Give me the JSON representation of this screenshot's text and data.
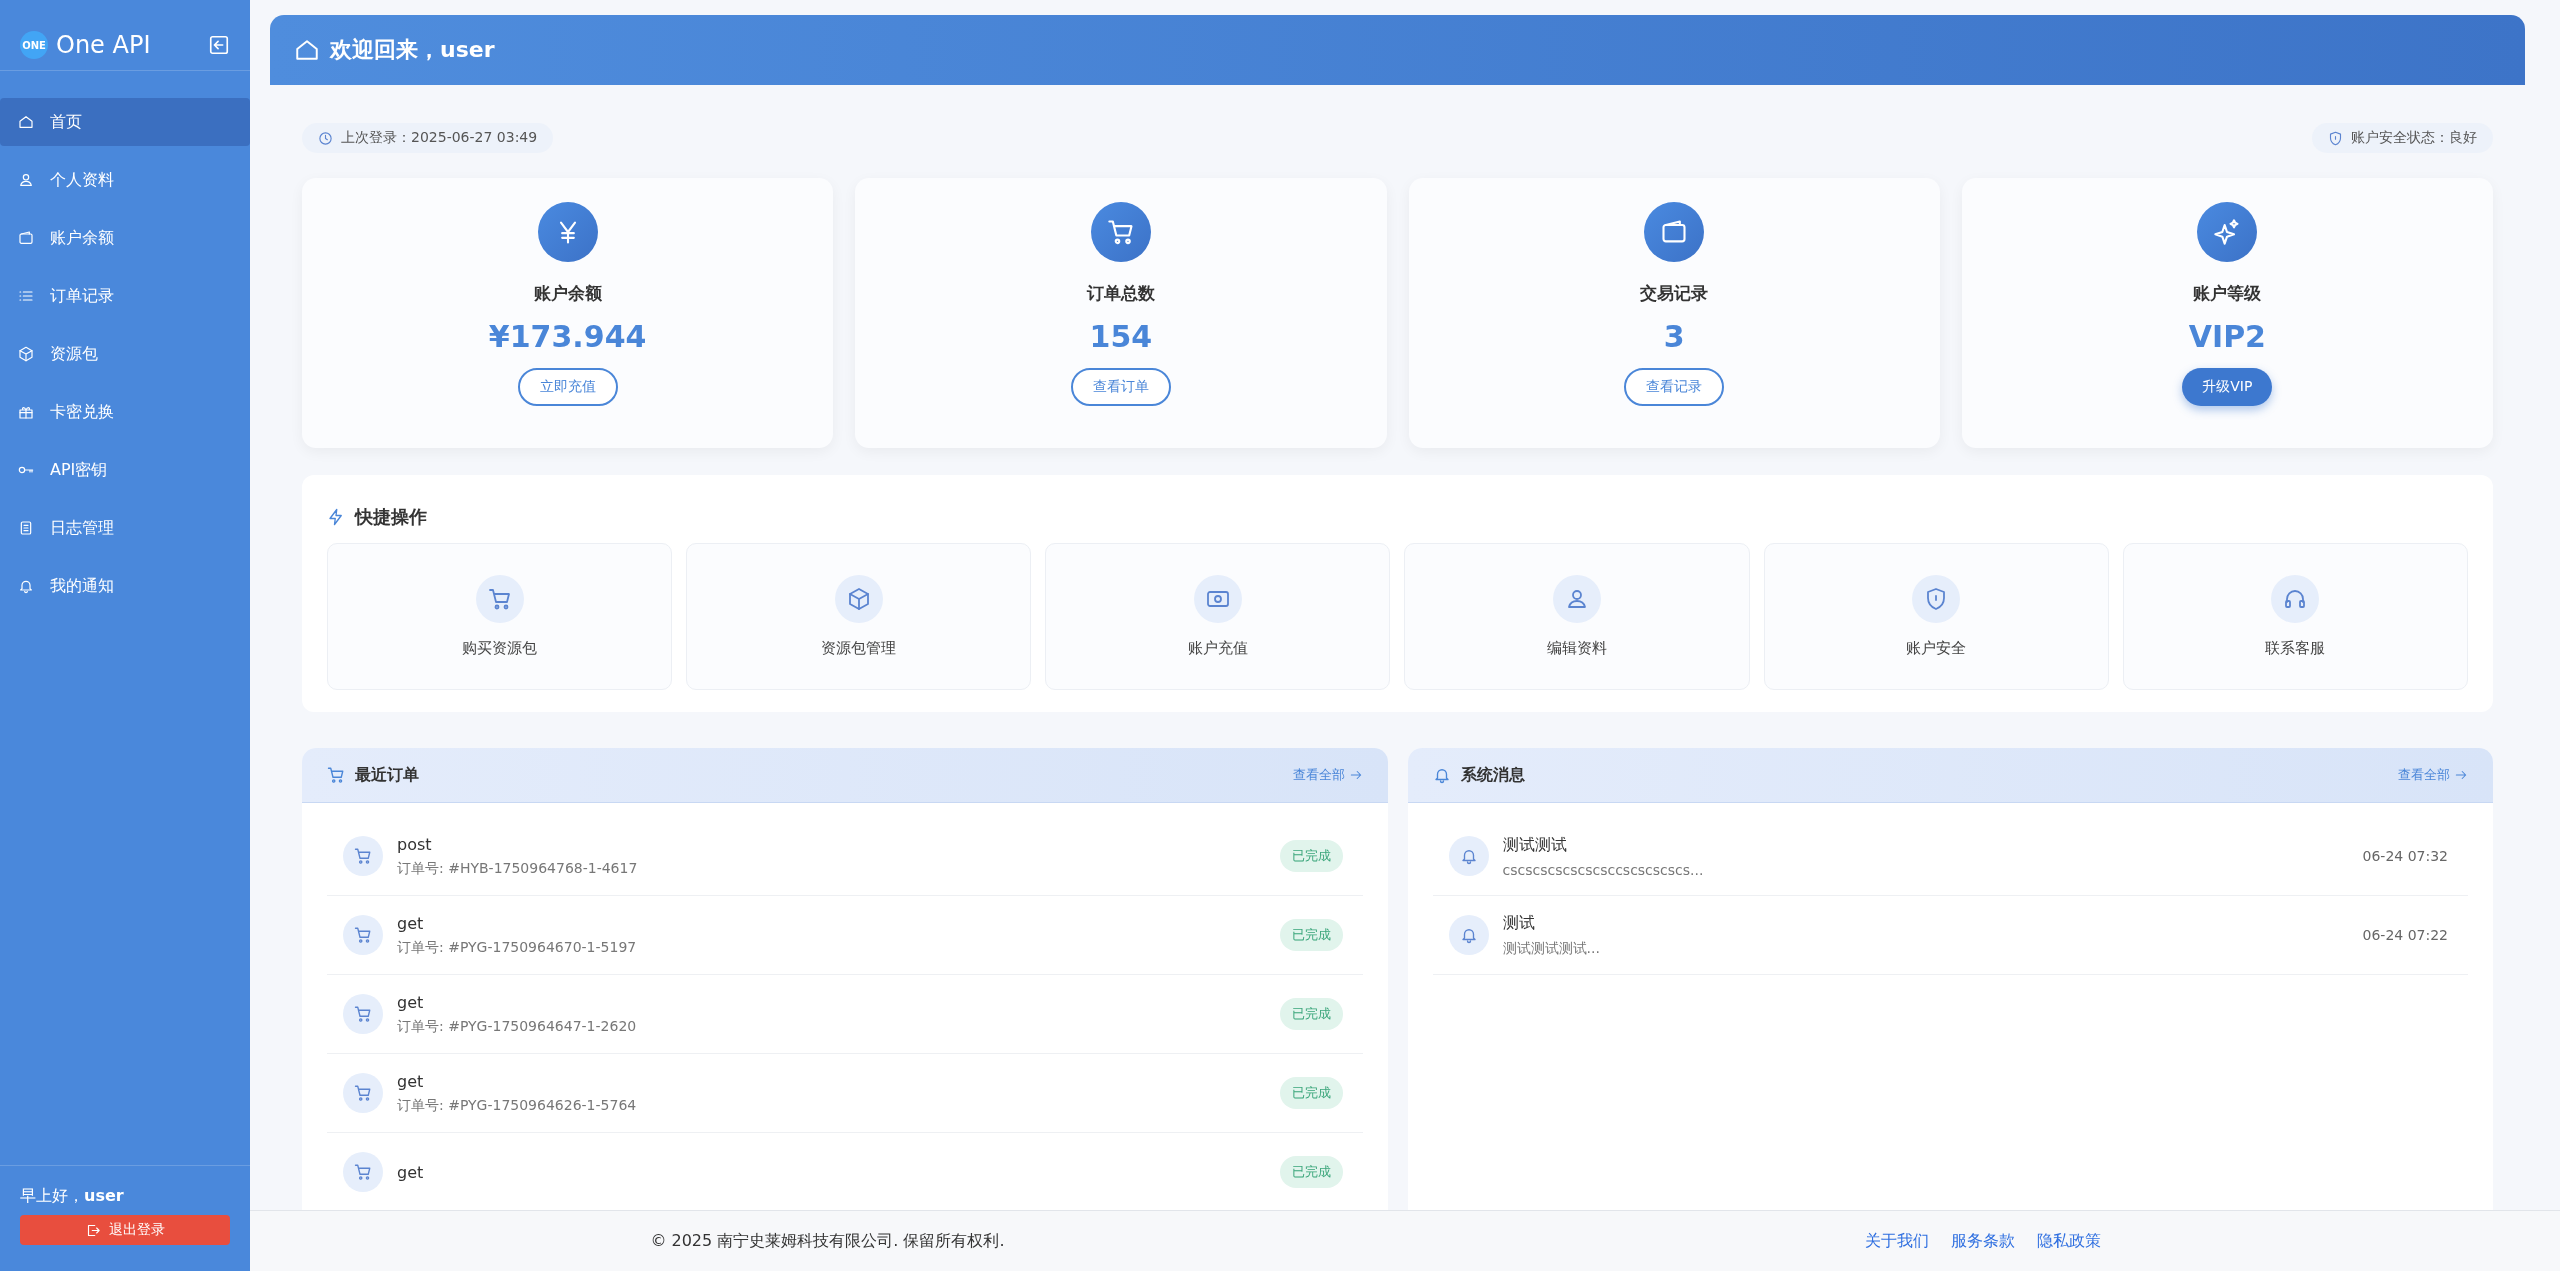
{
  "sidebar": {
    "logo_text": "ONE",
    "title": "One API",
    "items": [
      {
        "label": "首页",
        "selected": true
      },
      {
        "label": "个人资料",
        "selected": false
      },
      {
        "label": "账户余额",
        "selected": false
      },
      {
        "label": "订单记录",
        "selected": false
      },
      {
        "label": "资源包",
        "selected": false
      },
      {
        "label": "卡密兑换",
        "selected": false
      },
      {
        "label": "API密钥",
        "selected": false
      },
      {
        "label": "日志管理",
        "selected": false
      },
      {
        "label": "我的通知",
        "selected": false
      }
    ],
    "greeting": "早上好，**user**",
    "logout": "退出登录"
  },
  "header": {
    "title": "欢迎回来，user"
  },
  "last_login": "上次登录：2025-06-27 03:49",
  "security_status": "账户安全状态：良好",
  "stats": [
    {
      "label": "账户余额",
      "value": "¥173.944",
      "button": "立即充值",
      "kind": "outline"
    },
    {
      "label": "订单总数",
      "value": "154",
      "button": "查看订单",
      "kind": "outline"
    },
    {
      "label": "交易记录",
      "value": "3",
      "button": "查看记录",
      "kind": "outline"
    },
    {
      "label": "账户等级",
      "value": "VIP2",
      "button": "升级VIP",
      "kind": "solid"
    }
  ],
  "quick_actions": {
    "title": "快捷操作",
    "items": [
      {
        "label": "购买资源包"
      },
      {
        "label": "资源包管理"
      },
      {
        "label": "账户充值"
      },
      {
        "label": "编辑资料"
      },
      {
        "label": "账户安全"
      },
      {
        "label": "联系客服"
      }
    ]
  },
  "recent_orders": {
    "title": "最近订单",
    "link": "查看全部",
    "rows": [
      {
        "title": "post",
        "order_no": "订单号: #HYB-1750964768-1-4617",
        "status": "已完成"
      },
      {
        "title": "get",
        "order_no": "订单号: #PYG-1750964670-1-5197",
        "status": "已完成"
      },
      {
        "title": "get",
        "order_no": "订单号: #PYG-1750964647-1-2620",
        "status": "已完成"
      },
      {
        "title": "get",
        "order_no": "订单号: #PYG-1750964626-1-5764",
        "status": "已完成"
      },
      {
        "title": "get",
        "status": "已完成"
      }
    ]
  },
  "system_messages": {
    "title": "系统消息",
    "link": "查看全部",
    "rows": [
      {
        "title": "测试测试",
        "body": "cscscscscscscsccscscscscs...",
        "time": "06-24 07:32"
      },
      {
        "title": "测试",
        "body": "测试测试测试...",
        "time": "06-24 07:22"
      }
    ]
  },
  "footer": {
    "copyright": "© 2025 南宁史莱姆科技有限公司. 保留所有权利.",
    "links": [
      "关于我们",
      "服务条款",
      "隐私政策"
    ]
  }
}
